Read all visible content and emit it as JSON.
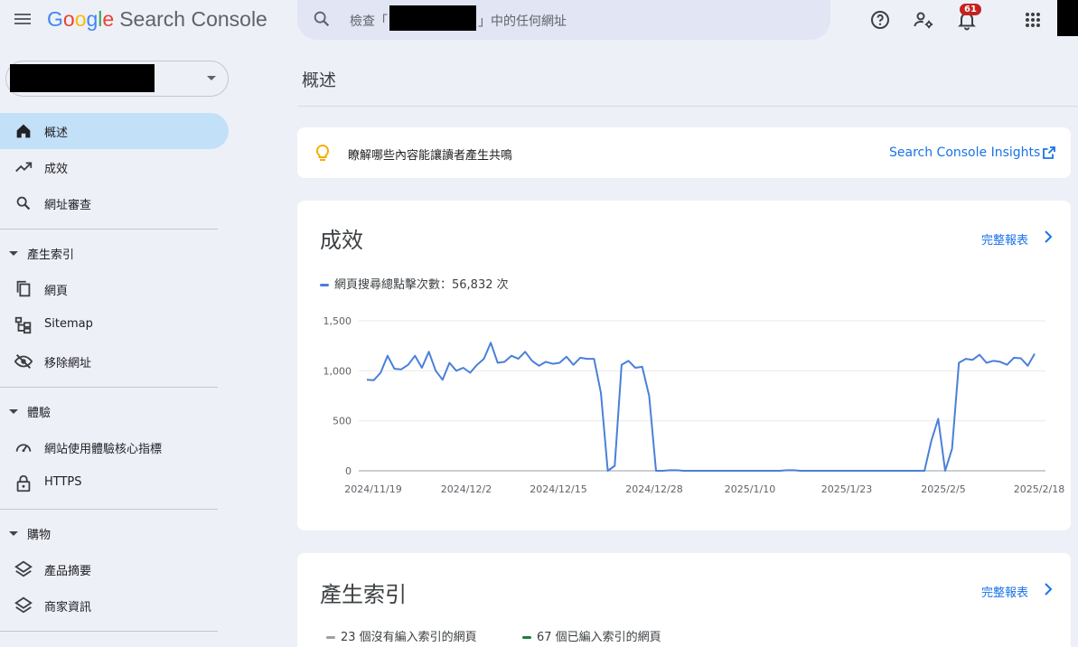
{
  "app": {
    "logo_letters": [
      "G",
      "o",
      "o",
      "g",
      "l",
      "e"
    ],
    "product": "Search Console"
  },
  "search": {
    "prefix": "檢查「",
    "suffix": "」中的任何網址"
  },
  "header": {
    "notification_count": "61",
    "icons": [
      "help-icon",
      "manage-accounts-icon",
      "notifications-icon",
      "apps-grid-icon"
    ]
  },
  "sidebar": {
    "items": [
      {
        "label": "概述",
        "icon": "home-icon",
        "active": true
      },
      {
        "label": "成效",
        "icon": "trending-up-icon"
      },
      {
        "label": "網址審查",
        "icon": "search-icon"
      }
    ],
    "sections": [
      {
        "label": "產生索引",
        "items": [
          {
            "label": "網頁",
            "icon": "pages-icon"
          },
          {
            "label": "Sitemap",
            "icon": "sitemap-icon"
          },
          {
            "label": "移除網址",
            "icon": "visibility-off-icon"
          }
        ]
      },
      {
        "label": "體驗",
        "items": [
          {
            "label": "網站使用體驗核心指標",
            "icon": "speed-icon"
          },
          {
            "label": "HTTPS",
            "icon": "lock-icon"
          }
        ]
      },
      {
        "label": "購物",
        "items": [
          {
            "label": "產品摘要",
            "icon": "layers-icon"
          },
          {
            "label": "商家資訊",
            "icon": "layers-icon"
          }
        ]
      }
    ]
  },
  "main": {
    "title": "概述",
    "insight": {
      "text": "瞭解哪些內容能讓讀者產生共鳴",
      "link": "Search Console Insights"
    },
    "performance": {
      "title": "成效",
      "full_report": "完整報表",
      "legend": "網頁搜尋總點擊次數：56,832 次",
      "line_color": "#4a80d8"
    },
    "indexing": {
      "title": "產生索引",
      "full_report": "完整報表",
      "legend_not_indexed": "23 個沒有編入索引的網頁",
      "legend_indexed": "67 個已編入索引的網頁",
      "not_indexed_color": "#9aa0a6",
      "indexed_color": "#188038"
    }
  },
  "chart_data": {
    "type": "line",
    "title": "",
    "xlabel": "",
    "ylabel": "",
    "ylim": [
      0,
      1500
    ],
    "yticks": [
      "0",
      "500",
      "1,000",
      "1,500"
    ],
    "xticks": [
      "2024/11/19",
      "2024/12/2",
      "2024/12/15",
      "2024/12/28",
      "2025/1/10",
      "2025/1/23",
      "2025/2/5",
      "2025/2/18"
    ],
    "grid": true,
    "x_start": "2024/11/19",
    "x_end": "2025/2/21",
    "series": [
      {
        "name": "網頁搜尋總點擊次數",
        "color": "#4a80d8",
        "values": [
          910,
          905,
          980,
          1150,
          1020,
          1015,
          1060,
          1150,
          1030,
          1190,
          1000,
          910,
          1080,
          1000,
          1030,
          980,
          1060,
          1120,
          1280,
          1080,
          1090,
          1150,
          1120,
          1190,
          1100,
          1050,
          1090,
          1070,
          1080,
          1140,
          1060,
          1130,
          1120,
          1120,
          780,
          0,
          50,
          1060,
          1100,
          1030,
          1040,
          750,
          0,
          0,
          5,
          5,
          0,
          0,
          0,
          0,
          0,
          0,
          0,
          0,
          0,
          0,
          0,
          0,
          0,
          0,
          0,
          5,
          5,
          0,
          0,
          0,
          0,
          0,
          0,
          0,
          0,
          0,
          0,
          0,
          0,
          0,
          0,
          0,
          0,
          0,
          0,
          0,
          300,
          520,
          0,
          220,
          1080,
          1120,
          1110,
          1160,
          1080,
          1100,
          1090,
          1060,
          1130,
          1125,
          1050,
          1170
        ]
      }
    ]
  }
}
